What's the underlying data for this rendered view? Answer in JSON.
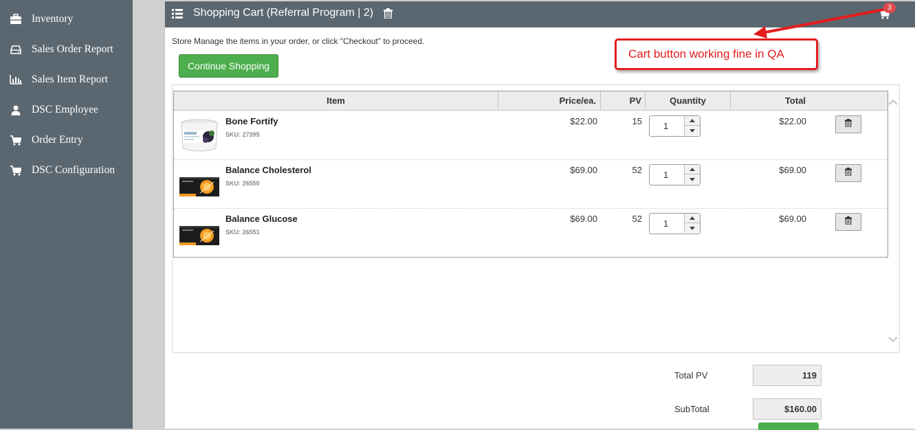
{
  "sidebar": {
    "items": [
      {
        "label": "Inventory",
        "icon": "briefcase-icon"
      },
      {
        "label": "Sales Order Report",
        "icon": "hdd-icon"
      },
      {
        "label": "Sales Item Report",
        "icon": "bar-chart-icon"
      },
      {
        "label": "DSC Employee",
        "icon": "user-icon"
      },
      {
        "label": "Order Entry",
        "icon": "cart-icon"
      },
      {
        "label": "DSC Configuration",
        "icon": "cart-icon"
      }
    ]
  },
  "header": {
    "title": "Shopping Cart (Referral Program | 2)",
    "cart_count": "3"
  },
  "instructions": "Store Manage the items in your order, or click \"Checkout\" to proceed.",
  "continue_label": "Continue Shopping",
  "annotation": "Cart button working fine in QA",
  "table": {
    "headers": {
      "item": "Item",
      "price": "Price/ea.",
      "pv": "PV",
      "quantity": "Quantity",
      "total": "Total"
    },
    "rows": [
      {
        "name": "Bone Fortify",
        "sku": "SKU: 27395",
        "price": "$22.00",
        "pv": "15",
        "qty": "1",
        "total": "$22.00",
        "image": "bone-fortify-jar"
      },
      {
        "name": "Balance Cholesterol",
        "sku": "SKU: 26550",
        "price": "$69.00",
        "pv": "52",
        "qty": "1",
        "total": "$69.00",
        "image": "orange-box"
      },
      {
        "name": "Balance Glucose",
        "sku": "SKU: 26551",
        "price": "$69.00",
        "pv": "52",
        "qty": "1",
        "total": "$69.00",
        "image": "orange-box"
      }
    ]
  },
  "summary": {
    "total_pv_label": "Total PV",
    "total_pv": "119",
    "subtotal_label": "SubTotal",
    "subtotal": "$160.00"
  },
  "colors": {
    "sidebar": "#5b6770",
    "header": "#5b6770",
    "primary_green": "#4cae4c",
    "annotation_red": "#e31c1c",
    "badge_red": "#e04a4a"
  }
}
